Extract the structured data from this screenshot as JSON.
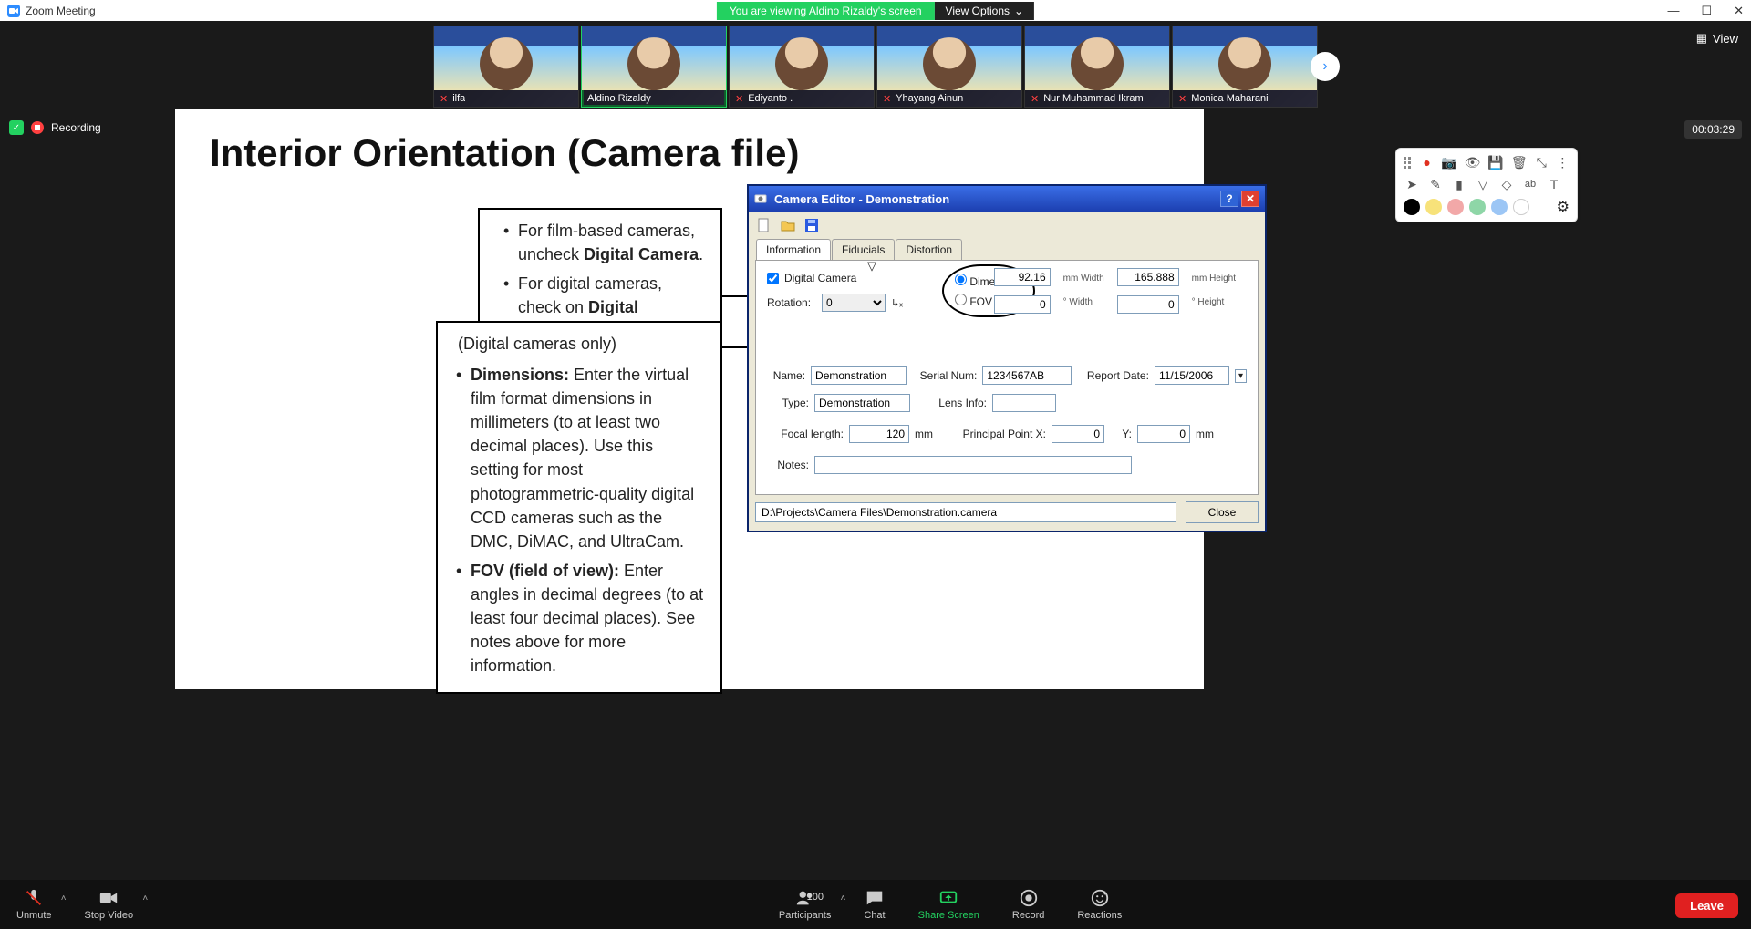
{
  "app": {
    "title": "Zoom Meeting"
  },
  "banner": {
    "text": "You are viewing Aldino Rizaldy's screen",
    "view_options": "View Options"
  },
  "view_button": "View",
  "recording": {
    "label": "Recording"
  },
  "timer": "00:03:29",
  "participants": [
    {
      "name": "ilfa",
      "muted": true
    },
    {
      "name": "Aldino Rizaldy",
      "muted": false,
      "speaker": true
    },
    {
      "name": "Ediyanto .",
      "muted": true
    },
    {
      "name": "Yhayang Ainun",
      "muted": true
    },
    {
      "name": "Nur Muhammad Ikram",
      "muted": true
    },
    {
      "name": "Monica Maharani",
      "muted": true
    }
  ],
  "slide": {
    "title": "Interior Orientation (Camera file)",
    "box1": {
      "b1_a": "For film-based cameras, uncheck ",
      "b1_a_bold": "Digital Camera",
      "b1_b": "For digital cameras, check on ",
      "b1_b_bold": "Digital Camera"
    },
    "box2": {
      "header": "(Digital cameras only)",
      "dim_label": "Dimensions:",
      "dim_text": " Enter the virtual film format dimensions in millimeters (to at least two decimal places). Use this setting for most photogrammetric-quality digital CCD cameras such as the DMC, DiMAC, and UltraCam.",
      "fov_label": "FOV (field of view):",
      "fov_text": " Enter angles in decimal degrees (to at least four decimal places). See notes above for more information."
    }
  },
  "camera_editor": {
    "title": "Camera Editor - Demonstration",
    "tabs": {
      "info": "Information",
      "fid": "Fiducials",
      "dist": "Distortion"
    },
    "digital_camera_label": "Digital Camera",
    "rotation_label": "Rotation:",
    "rotation_value": "0",
    "dimensions_label": "Dimensions",
    "fov_label": "FOV",
    "width_mm": "92.16",
    "height_mm": "165.888",
    "width_deg": "0",
    "height_deg": "0",
    "unit_mm_w": "mm Width",
    "unit_mm_h": "mm Height",
    "unit_deg_w": "° Width",
    "unit_deg_h": "° Height",
    "name_label": "Name:",
    "name_value": "Demonstration",
    "serial_label": "Serial Num:",
    "serial_value": "1234567AB",
    "report_label": "Report Date:",
    "report_value": "11/15/2006",
    "type_label": "Type:",
    "type_value": "Demonstration",
    "lens_label": "Lens Info:",
    "lens_value": "",
    "focal_label": "Focal length:",
    "focal_value": "120",
    "focal_unit": "mm",
    "ppx_label": "Principal Point X:",
    "ppx_value": "0",
    "ppy_label": "Y:",
    "ppy_value": "0",
    "pp_unit": "mm",
    "notes_label": "Notes:",
    "notes_value": "",
    "path": "D:\\Projects\\Camera Files\\Demonstration.camera",
    "close": "Close"
  },
  "annot_colors": [
    "#000000",
    "#f7e27a",
    "#f2a8a8",
    "#8ed6a7",
    "#9cc6f5",
    "#ffffff"
  ],
  "toolbar": {
    "unmute": "Unmute",
    "stop_video": "Stop Video",
    "participants": "Participants",
    "participant_count": "100",
    "chat": "Chat",
    "share": "Share Screen",
    "record": "Record",
    "reactions": "Reactions",
    "leave": "Leave"
  }
}
